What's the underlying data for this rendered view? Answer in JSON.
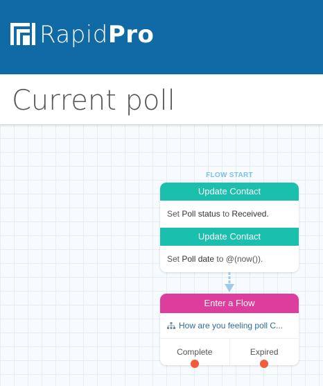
{
  "header": {
    "logo_light": "Rapid",
    "logo_bold": "Pro"
  },
  "page": {
    "title": "Current poll"
  },
  "flow": {
    "start_label": "FLOW START",
    "actions_node": {
      "actions": [
        {
          "header": "Update Contact",
          "prefix": "Set",
          "field": "Poll status",
          "mid": "to",
          "value": "Received."
        },
        {
          "header": "Update Contact",
          "prefix": "Set",
          "field": "Poll date",
          "mid": "to",
          "value": "@(now())."
        }
      ]
    },
    "subflow_node": {
      "header": "Enter a Flow",
      "flow_name": "How are you feeling poll C...",
      "icon": "flow-hierarchy-icon",
      "exits": [
        "Complete",
        "Expired"
      ]
    }
  },
  "colors": {
    "topbar": "#0f6aa6",
    "action_header": "#1bbfae",
    "subflow_header": "#dd3d9c",
    "exit_dot": "#f15d3b",
    "connector": "#9bcbe8"
  }
}
